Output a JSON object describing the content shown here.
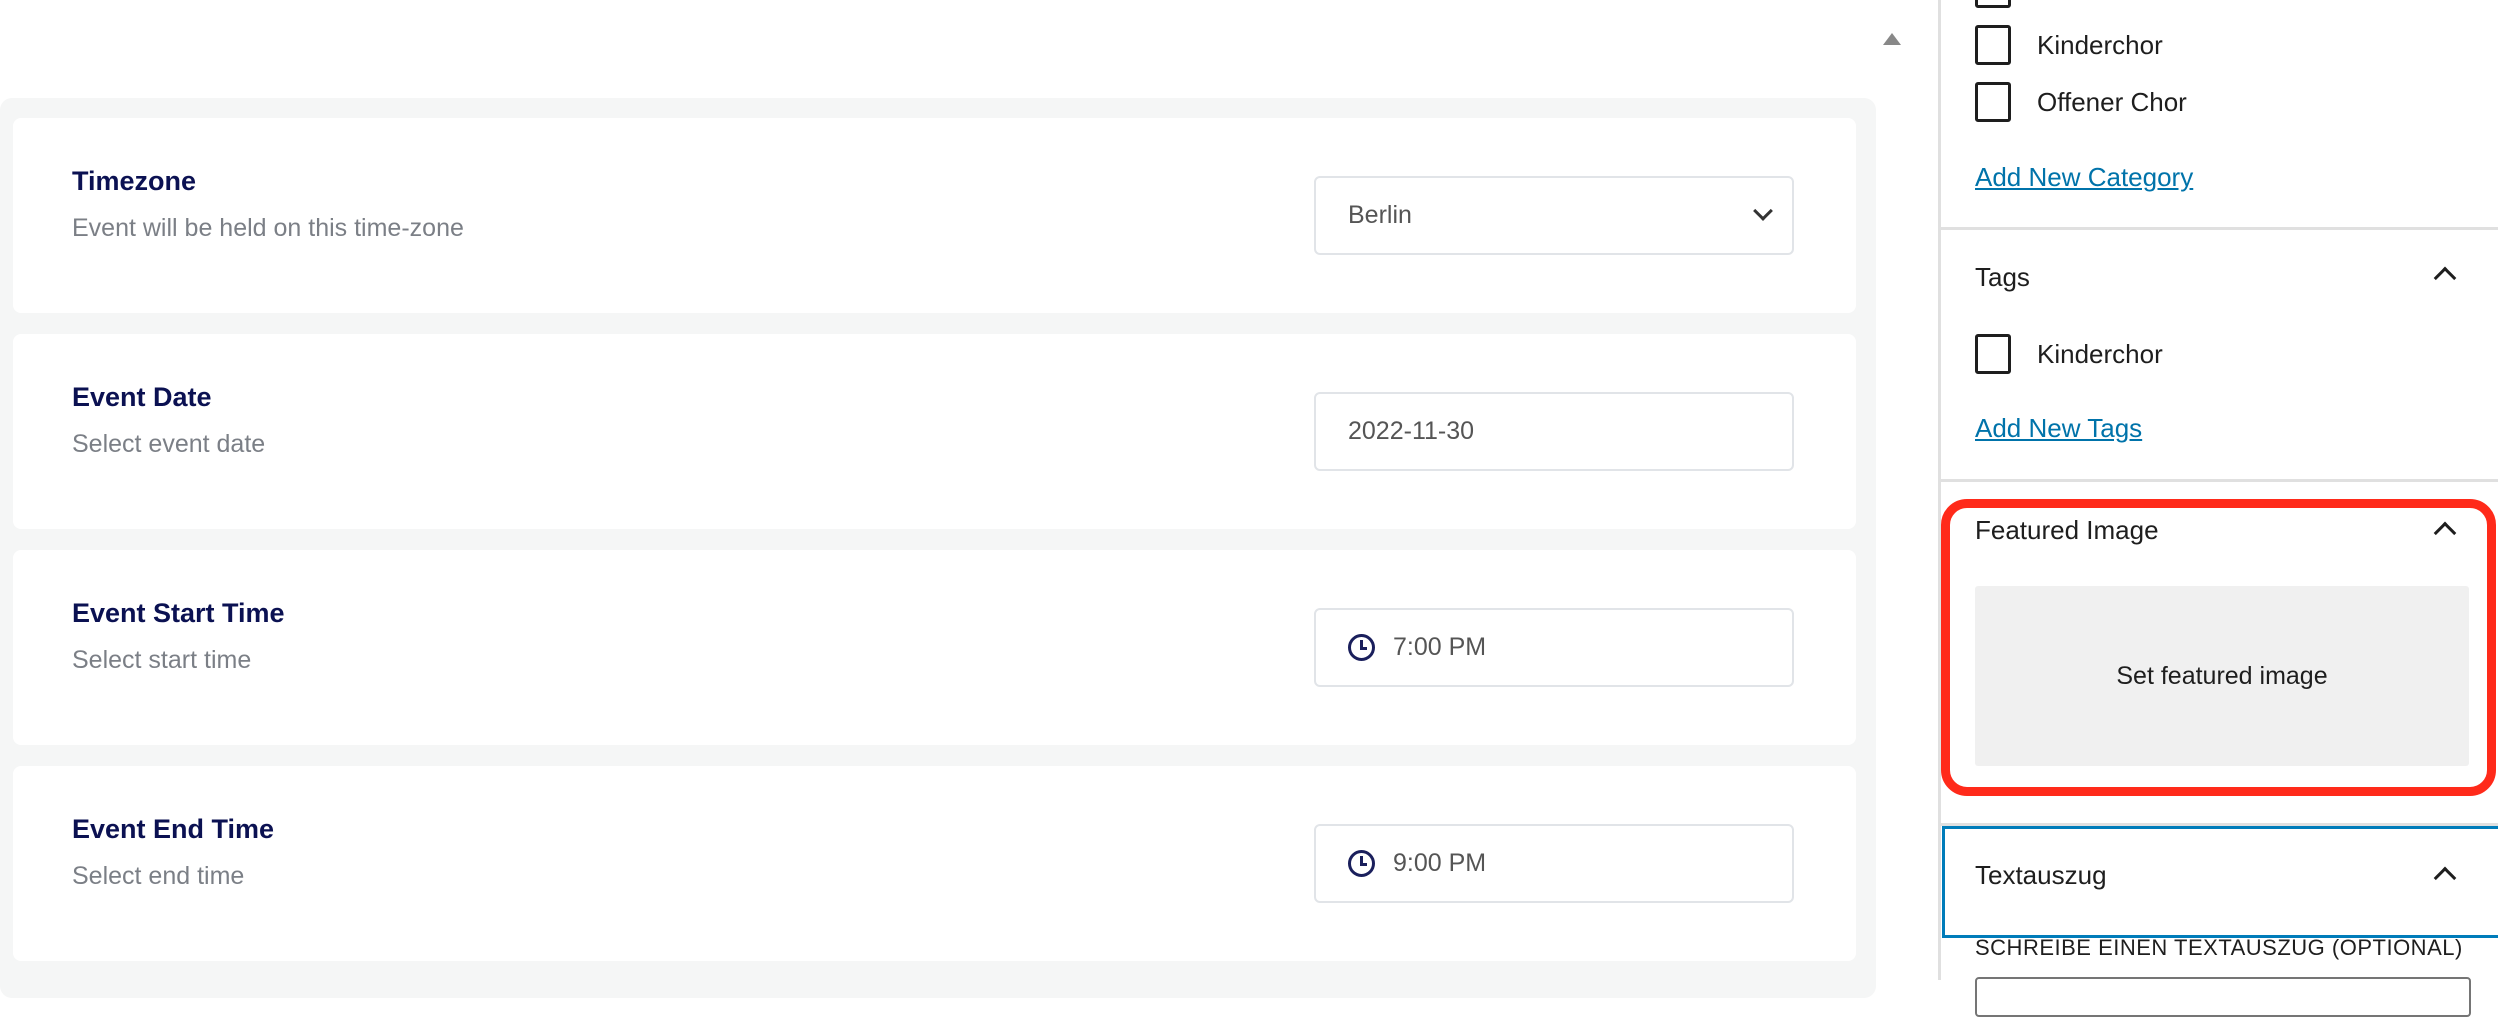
{
  "main": {
    "cards": [
      {
        "title": "Timezone",
        "subtitle": "Event will be held on this time-zone",
        "value": "Berlin",
        "control": "select"
      },
      {
        "title": "Event Date",
        "subtitle": "Select event date",
        "value": "2022-11-30",
        "control": "date"
      },
      {
        "title": "Event Start Time",
        "subtitle": "Select start time",
        "value": "7:00 PM",
        "control": "time"
      },
      {
        "title": "Event End Time",
        "subtitle": "Select end time",
        "value": "9:00 PM",
        "control": "time"
      }
    ]
  },
  "sidebar": {
    "categories": {
      "items": [
        "Kinderchor",
        "Offener Chor"
      ],
      "add_link": "Add New Category"
    },
    "tags": {
      "title": "Tags",
      "items": [
        "Kinderchor"
      ],
      "add_link": "Add New Tags"
    },
    "featured_image": {
      "title": "Featured Image",
      "button": "Set featured image",
      "highlight_color": "#ff2a1a"
    },
    "excerpt": {
      "title": "Textauszug",
      "label": "SCHREIBE EINEN TEXTAUSZUG (OPTIONAL)"
    }
  }
}
